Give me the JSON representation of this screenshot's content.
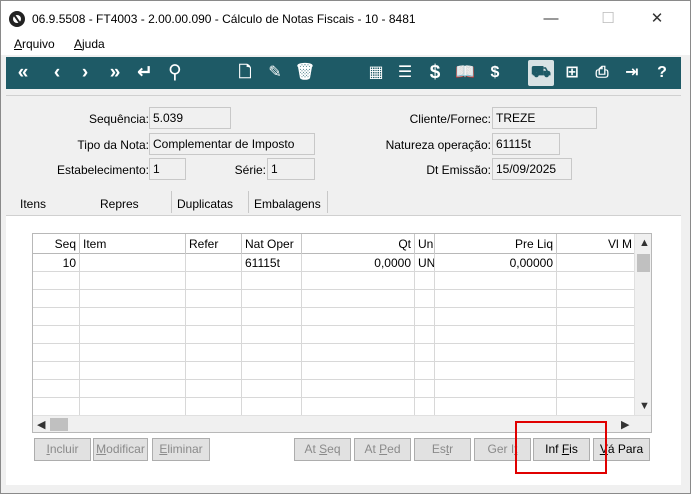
{
  "window": {
    "title": "06.9.5508 - FT4003 - 2.00.00.090 - Cálculo de Notas Fiscais - 10 - 8481",
    "minimize": "—",
    "maximize": "☐",
    "close": "✕"
  },
  "menu": [
    {
      "label": "Arquivo",
      "accel": "A",
      "rest": "rquivo"
    },
    {
      "label": "Ajuda",
      "accel": "A",
      "rest": "juda"
    }
  ],
  "toolbar": {
    "icons": [
      "first-icon",
      "prev-icon",
      "next-icon",
      "last-icon",
      "return-icon",
      "search-icon",
      "new-doc-icon",
      "edit-doc-icon",
      "delete-icon",
      "calculator-icon",
      "report-icon",
      "dollar-icon",
      "book-icon",
      "invoice-icon",
      "truck-icon",
      "tree-icon",
      "print-icon",
      "exit-icon",
      "help-icon"
    ],
    "glyphs": {
      "first": "«",
      "prev": "‹",
      "next": "›",
      "last": "»",
      "return": "↵",
      "search": "⚲",
      "new_doc": "🗋",
      "edit_doc": "✎",
      "delete": "🗑",
      "calculator": "▦",
      "report": "☰",
      "dollar": "$",
      "book": "📖",
      "invoice": "$",
      "truck": "⛟",
      "tree": "⊞",
      "print": "⎙",
      "exit": "⇥",
      "help": "?"
    }
  },
  "header": {
    "sequencia_label": "Sequência:",
    "sequencia_value": "5.039",
    "tipo_nota_label": "Tipo da Nota:",
    "tipo_nota_value": "Complementar de Imposto",
    "estabelecimento_label": "Estabelecimento:",
    "estabelecimento_value": "1",
    "serie_label": "Série:",
    "serie_value": "1",
    "cliente_label": "Cliente/Fornec:",
    "cliente_value": "TREZE",
    "natureza_label": "Natureza operação:",
    "natureza_value": "61115t",
    "dt_emissao_label": "Dt Emissão:",
    "dt_emissao_value": "15/09/2025"
  },
  "tabs": [
    {
      "label": "Itens",
      "active": true
    },
    {
      "label": "Repres"
    },
    {
      "label": "Duplicatas"
    },
    {
      "label": "Embalagens"
    }
  ],
  "grid": {
    "columns": [
      "Seq",
      "Item",
      "Refer",
      "Nat Oper",
      "Qt",
      "Un",
      "Pre Liq",
      "Vl M"
    ],
    "rows": [
      {
        "seq": "10",
        "item": "",
        "refer": "",
        "nat_oper": "61115t",
        "qt": "0,0000",
        "un": "UN",
        "pre_liq": "0,00000",
        "vl_m": ""
      }
    ]
  },
  "buttons": {
    "incluir": {
      "accel": "I",
      "rest": "ncluir"
    },
    "modificar": {
      "accel": "M",
      "rest": "odificar"
    },
    "eliminar": {
      "accel": "E",
      "rest": "liminar"
    },
    "at_seq": {
      "pre": "At ",
      "accel": "S",
      "rest": "eq"
    },
    "at_ped": {
      "pre": "At ",
      "accel": "P",
      "rest": "ed"
    },
    "estr": {
      "pre": "Es",
      "accel": "t",
      "rest": "r"
    },
    "ger_it": {
      "pre": "Ger I",
      "accel": "t",
      "rest": ""
    },
    "inf_fis": {
      "pre": "Inf ",
      "accel": "F",
      "rest": "is"
    },
    "va_para": {
      "pre": "",
      "accel": "V",
      "rest": "á Para"
    }
  }
}
